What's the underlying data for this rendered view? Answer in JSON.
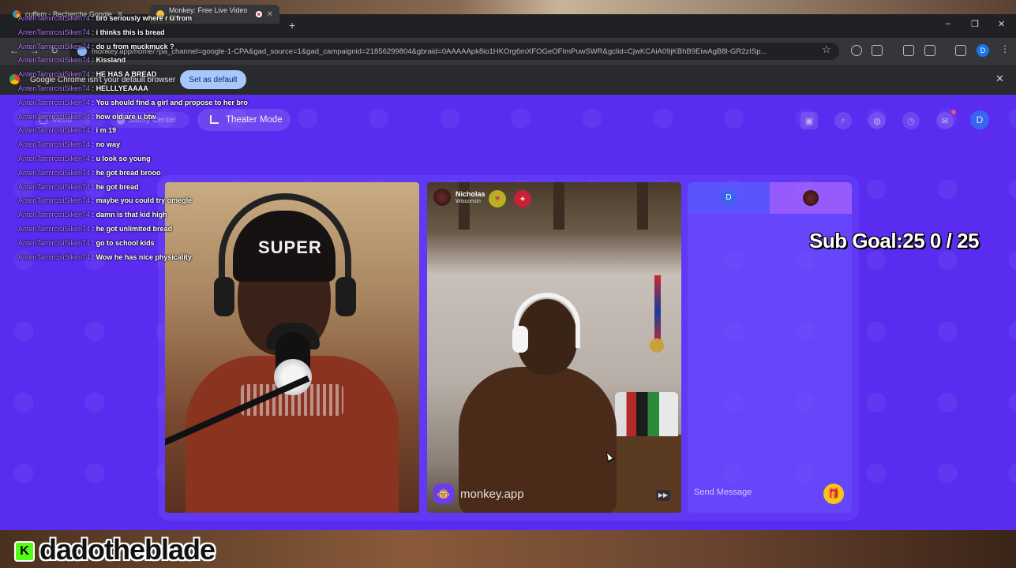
{
  "browser": {
    "tabs": [
      {
        "label": "cuffem - Recherche Google",
        "active": false
      },
      {
        "label": "Monkey: Free Live Video Ch",
        "active": true
      }
    ],
    "new_tab_glyph": "+",
    "window_controls": [
      "–",
      "❐",
      "✕"
    ],
    "url": "monkey.app/home/?pa_channel=google-1-CPA&gad_source=1&gad_campaignid=21856299804&gbraid=0AAAAApk8io1HKOrg6mXFOGeOFImPuwSWR&gclid=CjwKCAiA09jKBhB9EiwAgB8l-GR2zISp...",
    "profile_initial": "D",
    "infobar": {
      "message": "Google Chrome isn't your default browser",
      "button": "Set as default"
    }
  },
  "app": {
    "menu_label": "Menu",
    "safety_label": "Safety Center",
    "theater_mode": "Theater Mode",
    "header_icons": [
      "shop-icon",
      "search-icon",
      "globe-icon",
      "history-icon",
      "messages-icon"
    ],
    "avatar_initial": "D",
    "partner": {
      "name": "Nicholas",
      "location": "Wisconsin"
    },
    "watermark": "monkey.app",
    "chat": {
      "self_initial": "D",
      "placeholder": "Send Message"
    }
  },
  "overlay": {
    "stream_chat": [
      {
        "user": "AntenTamircisiSiken74",
        "message": "bro seriously where r u from"
      },
      {
        "user": "AntenTamircisiSiken74",
        "message": "i thinks this is bread"
      },
      {
        "user": "AntenTamircisiSiken74",
        "message": "do u from muckmuck ?"
      },
      {
        "user": "AntenTamircisiSiken74",
        "message": "Kissland"
      },
      {
        "user": "AntenTamircisiSiken74",
        "message": "HE HAS A BREAD"
      },
      {
        "user": "AntenTamircisiSiken74",
        "message": "HELLLYEAAAA"
      },
      {
        "user": "AntenTamircisiSiken74",
        "message": "You should find a girl and propose to her bro"
      },
      {
        "user": "AntenTamircisiSiken74",
        "message": "how old are u btw"
      },
      {
        "user": "AntenTamircisiSiken74",
        "message": "i m 19"
      },
      {
        "user": "AntenTamircisiSiken74",
        "message": "no way"
      },
      {
        "user": "AntenTamircisiSiken74",
        "message": "u look so young"
      },
      {
        "user": "AntenTamircisiSiken74",
        "message": "he got bread brooo"
      },
      {
        "user": "AntenTamircisiSiken74",
        "message": "he got bread"
      },
      {
        "user": "AntenTamircisiSiken74",
        "message": "maybe you could try omegle"
      },
      {
        "user": "AntenTamircisiSiken74",
        "message": "damn is that kid high"
      },
      {
        "user": "AntenTamircisiSiken74",
        "message": "he got unlimited bread"
      },
      {
        "user": "AntenTamircisiSiken74",
        "message": "go to school kids"
      },
      {
        "user": "AntenTamircisiSiken74",
        "message": "Wow he has nice physicality"
      }
    ],
    "sub_goal": "Sub Goal:25  0 / 25",
    "kick_logo_letter": "K",
    "streamer_handle": "dadotheblade",
    "beanie_text": "SUPER"
  },
  "colors": {
    "app_background": "#5a2cf0",
    "chat_username": "#b57cff",
    "kick_green": "#53fc18",
    "infobar_button": "#a8c7fa"
  }
}
